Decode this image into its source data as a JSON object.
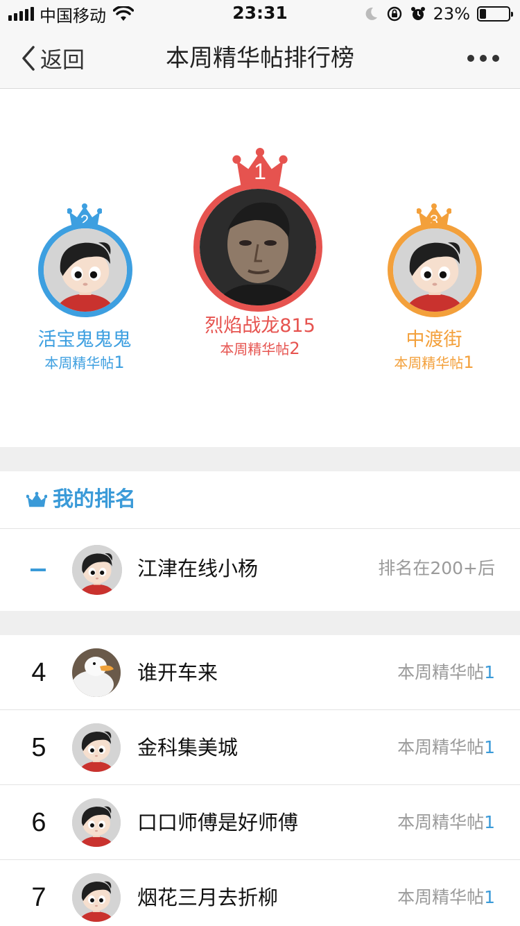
{
  "status_bar": {
    "carrier": "中国移动",
    "time": "23:31",
    "battery_percent": "23%",
    "battery_level": 0.23,
    "icons": [
      "signal-icon",
      "wifi-icon",
      "moon-icon",
      "rotation-lock-icon",
      "alarm-icon",
      "battery-icon"
    ]
  },
  "nav": {
    "back_label": "返回",
    "title": "本周精华帖排行榜",
    "more_icon": "more-icon"
  },
  "podium": {
    "first": {
      "rank": "1",
      "name": "烈焰战龙815",
      "sub_label": "本周精华帖",
      "count": "2",
      "color": "#e6534f"
    },
    "second": {
      "rank": "2",
      "name": "活宝鬼鬼鬼",
      "sub_label": "本周精华帖",
      "count": "1",
      "color": "#3d9fe0"
    },
    "third": {
      "rank": "3",
      "name": "中渡街",
      "sub_label": "本周精华帖",
      "count": "1",
      "color": "#f3a03b"
    }
  },
  "my_rank": {
    "title": "我的排名",
    "name": "江津在线小杨",
    "status": "排名在200+后"
  },
  "list": [
    {
      "rank": "4",
      "name": "谁开车来",
      "label": "本周精华帖",
      "count": "1",
      "avatar": "duck"
    },
    {
      "rank": "5",
      "name": "金科集美城",
      "label": "本周精华帖",
      "count": "1",
      "avatar": "default"
    },
    {
      "rank": "6",
      "name": "口口师傅是好师傅",
      "label": "本周精华帖",
      "count": "1",
      "avatar": "default"
    },
    {
      "rank": "7",
      "name": "烟花三月去折柳",
      "label": "本周精华帖",
      "count": "1",
      "avatar": "default"
    }
  ]
}
